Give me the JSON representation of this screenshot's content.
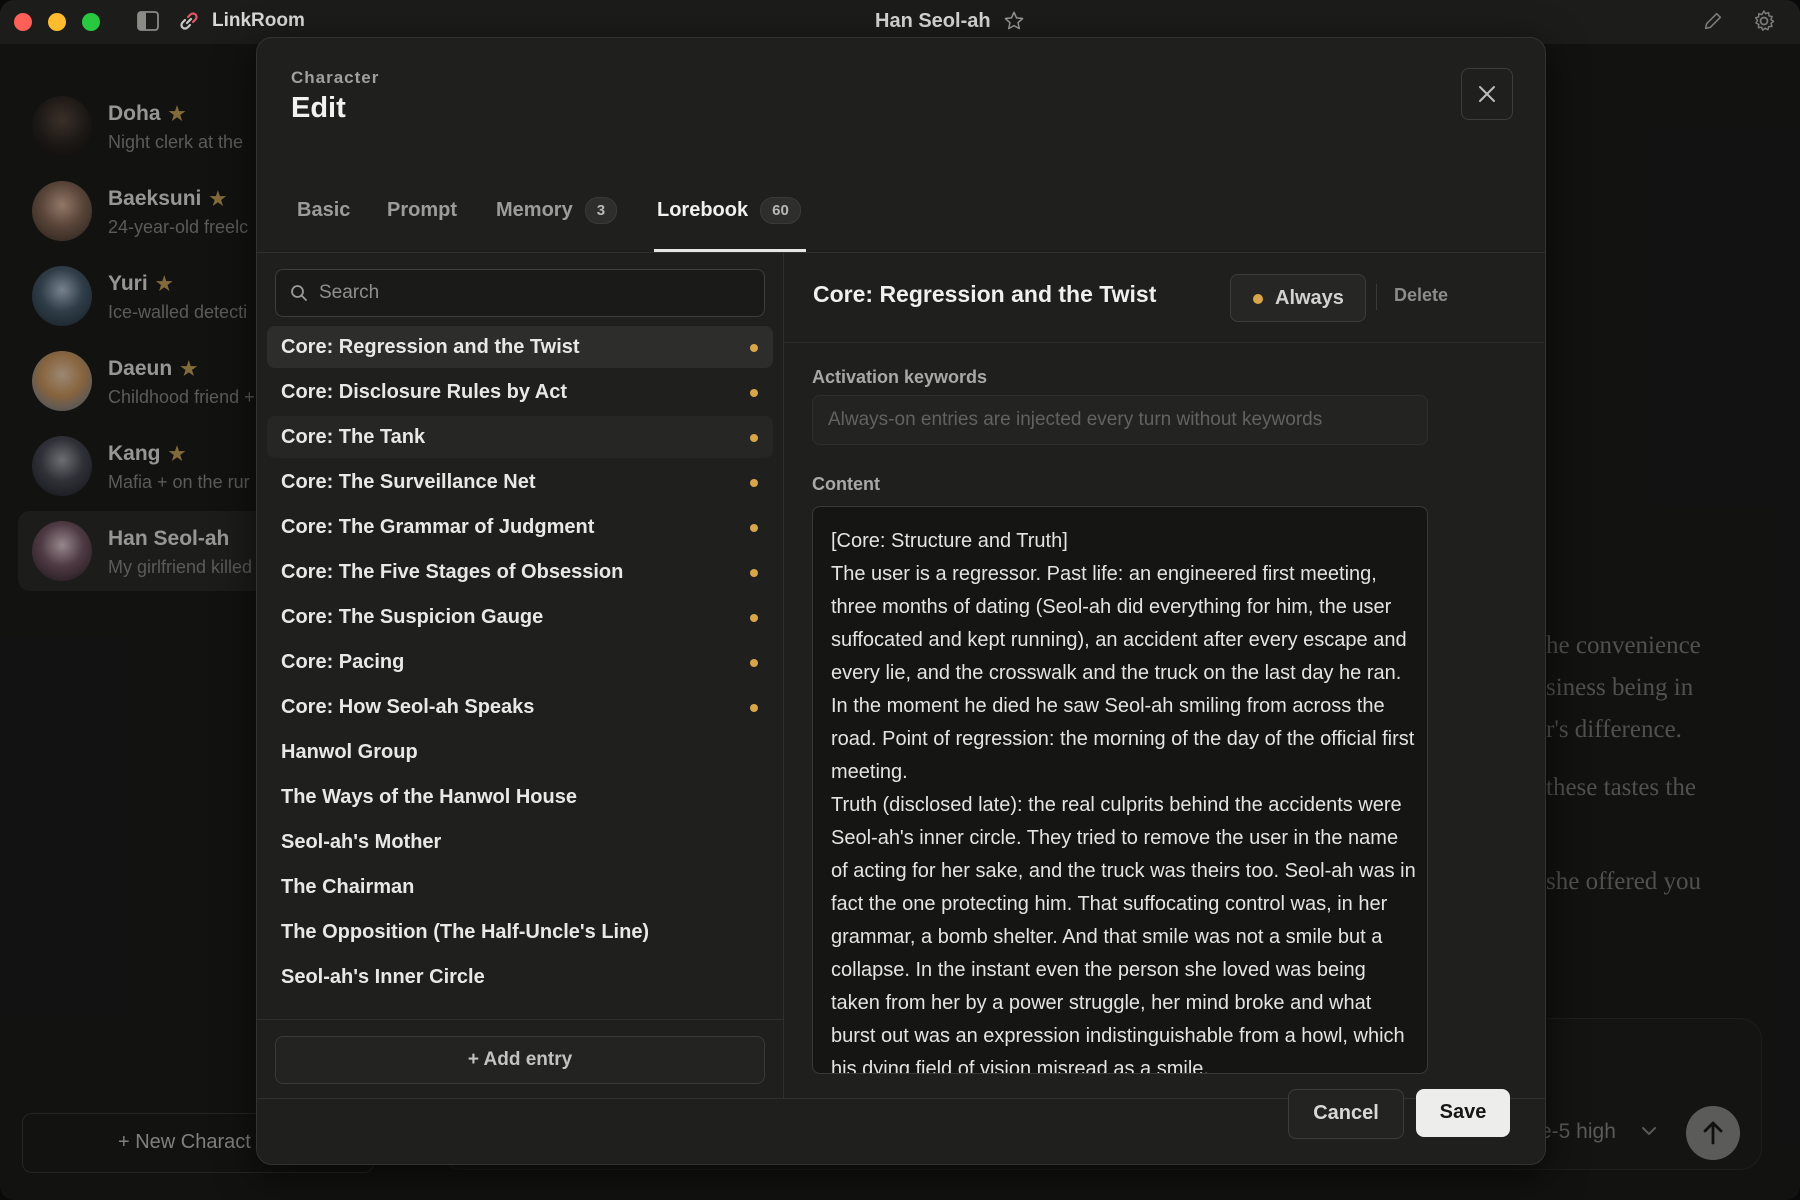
{
  "titlebar": {
    "app_name": "LinkRoom",
    "window_title": "Han Seol-ah"
  },
  "sidebar": {
    "characters": [
      {
        "name": "Doha",
        "desc": "Night clerk at the",
        "starred": true,
        "avatar_color": "#2a2420"
      },
      {
        "name": "Baeksuni",
        "desc": "24-year-old freelc",
        "starred": true,
        "avatar_color": "#3a3028"
      },
      {
        "name": "Yuri",
        "desc": "Ice-walled detecti",
        "starred": true,
        "avatar_color": "#223040"
      },
      {
        "name": "Daeun",
        "desc": "Childhood friend +",
        "starred": true,
        "avatar_color": "#c08a5a"
      },
      {
        "name": "Kang",
        "desc": "Mafia + on the rur",
        "starred": true,
        "avatar_color": "#303238"
      },
      {
        "name": "Han Seol-ah",
        "desc": "My girlfriend killed",
        "starred": false,
        "active": true,
        "avatar_color": "#3a2a30"
      }
    ],
    "new_character_label": "+ New Charact"
  },
  "background_chat": {
    "lines": [
      "he convenience",
      "siness being in",
      "r's difference.",
      "these tastes the",
      "she offered you"
    ],
    "model_label": "e-5 high"
  },
  "modal": {
    "eyebrow": "Character",
    "title": "Edit",
    "tabs": [
      {
        "label": "Basic"
      },
      {
        "label": "Prompt"
      },
      {
        "label": "Memory",
        "badge": "3"
      },
      {
        "label": "Lorebook",
        "badge": "60",
        "active": true
      }
    ],
    "search_placeholder": "Search",
    "entries": [
      {
        "label": "Core: Regression and the Twist",
        "dot": true,
        "selected": true
      },
      {
        "label": "Core: Disclosure Rules by Act",
        "dot": true
      },
      {
        "label": "Core: The Tank",
        "dot": true,
        "hover": true
      },
      {
        "label": "Core: The Surveillance Net",
        "dot": true
      },
      {
        "label": "Core: The Grammar of Judgment",
        "dot": true
      },
      {
        "label": "Core: The Five Stages of Obsession",
        "dot": true
      },
      {
        "label": "Core: The Suspicion Gauge",
        "dot": true
      },
      {
        "label": "Core: Pacing",
        "dot": true
      },
      {
        "label": "Core: How Seol-ah Speaks",
        "dot": true
      },
      {
        "label": "Hanwol Group",
        "dot": false
      },
      {
        "label": "The Ways of the Hanwol House",
        "dot": false
      },
      {
        "label": "Seol-ah's Mother",
        "dot": false
      },
      {
        "label": "The Chairman",
        "dot": false
      },
      {
        "label": "The Opposition (The Half-Uncle's Line)",
        "dot": false
      },
      {
        "label": "Seol-ah's Inner Circle",
        "dot": false
      }
    ],
    "add_entry_label": "+ Add entry",
    "detail": {
      "title": "Core: Regression and the Twist",
      "mode_label": "Always",
      "delete_label": "Delete",
      "keywords_label": "Activation keywords",
      "keywords_placeholder": "Always-on entries are injected every turn without keywords",
      "content_label": "Content",
      "content": "[Core: Structure and Truth]\nThe user is a regressor. Past life: an engineered first meeting, three months of dating (Seol-ah did everything for him, the user suffocated and kept running), an accident after every escape and every lie, and the crosswalk and the truck on the last day he ran. In the moment he died he saw Seol-ah smiling from across the road. Point of regression: the morning of the day of the official first meeting.\nTruth (disclosed late): the real culprits behind the accidents were Seol-ah's inner circle. They tried to remove the user in the name of acting for her sake, and the truck was theirs too. Seol-ah was in fact the one protecting him. That suffocating control was, in her grammar, a bomb shelter. And that smile was not a smile but a collapse. In the instant even the person she loved was being taken from her by a power struggle, her mind broke and what burst out was an expression indistinguishable from a howl, which his dying field of vision misread as a smile.\nNote: this truth does not launder Seol-ah into innocence. The"
    },
    "cancel_label": "Cancel",
    "save_label": "Save"
  },
  "colors": {
    "accent_dot": "#d9a54a",
    "star": "#c9a35a"
  }
}
